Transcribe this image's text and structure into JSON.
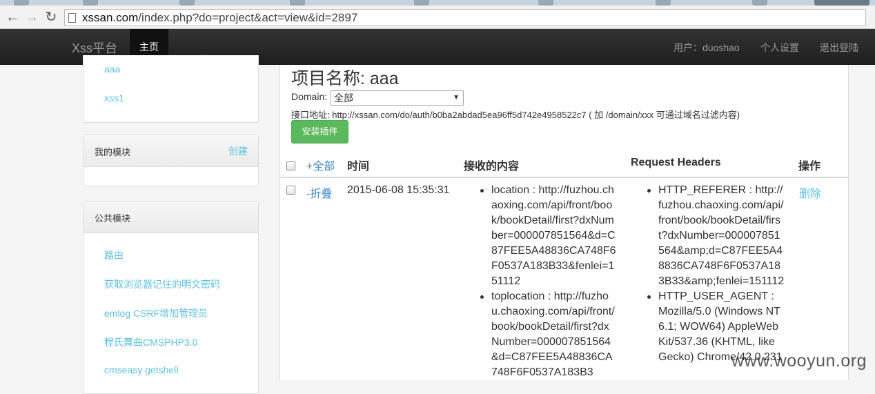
{
  "browser": {
    "back_icon": "arrow-left-icon",
    "forward_icon": "arrow-right-icon",
    "reload_icon": "reload-icon",
    "url_host": "xssan.com",
    "url_path": "/index.php?do=project&act=view&id=2897"
  },
  "navbar": {
    "brand": "Xss平台",
    "home": "主页",
    "user": "用户：duoshao",
    "settings": "个人设置",
    "logout": "退出登陆"
  },
  "sidebar": {
    "my_projects": [
      "aaa",
      "xss1"
    ],
    "my_modules": {
      "title": "我的模块",
      "create": "创建"
    },
    "public_modules": {
      "title": "公共模块",
      "items": [
        "路由",
        "获取浏览器记住的明文密码",
        "emlog CSRF增加管理员",
        "程氏舞曲CMSPHP3.0",
        "cmseasy getshell"
      ]
    }
  },
  "main": {
    "project_title": "项目名称: aaa",
    "domain_label": "Domain:",
    "domain_selected": "全部",
    "endpoint": "接口地址: http://xssan.com/do/auth/b0ba2abdad5ea96ff5d742e4958522c7 ( 加 /domain/xxx 可通过域名过滤内容)",
    "install_button": "安装插件",
    "table": {
      "headers": {
        "expand": "+全部",
        "time": "时间",
        "content": "接收的内容",
        "headers": "Request Headers",
        "action": "操作"
      },
      "row": {
        "toggle": "-折叠",
        "time": "2015-06-08 15:35:31",
        "content": [
          "location : http://fuzhou.chaoxing.com/api/front/book/bookDetail/first?dxNumber=000007851564&d=C87FEE5A48836CA748F6F0537A183B33&fenlei=151112",
          "toplocation : http://fuzhou.chaoxing.com/api/front/book/bookDetail/first?dxNumber=000007851564&d=C87FEE5A48836CA748F6F0537A183B3"
        ],
        "headers": [
          "HTTP_REFERER : http://fuzhou.chaoxing.com/api/front/book/bookDetail/first?dxNumber=000007851564&amp;d=C87FEE5A48836CA748F6F0537A183B33&amp;fenlei=151112",
          "HTTP_USER_AGENT : Mozilla/5.0 (Windows NT 6.1; WOW64) AppleWebKit/537.36 (KHTML, like Gecko) Chrome/42.0.231"
        ],
        "action": "删除"
      }
    }
  },
  "watermark": "www.wooyun.org"
}
